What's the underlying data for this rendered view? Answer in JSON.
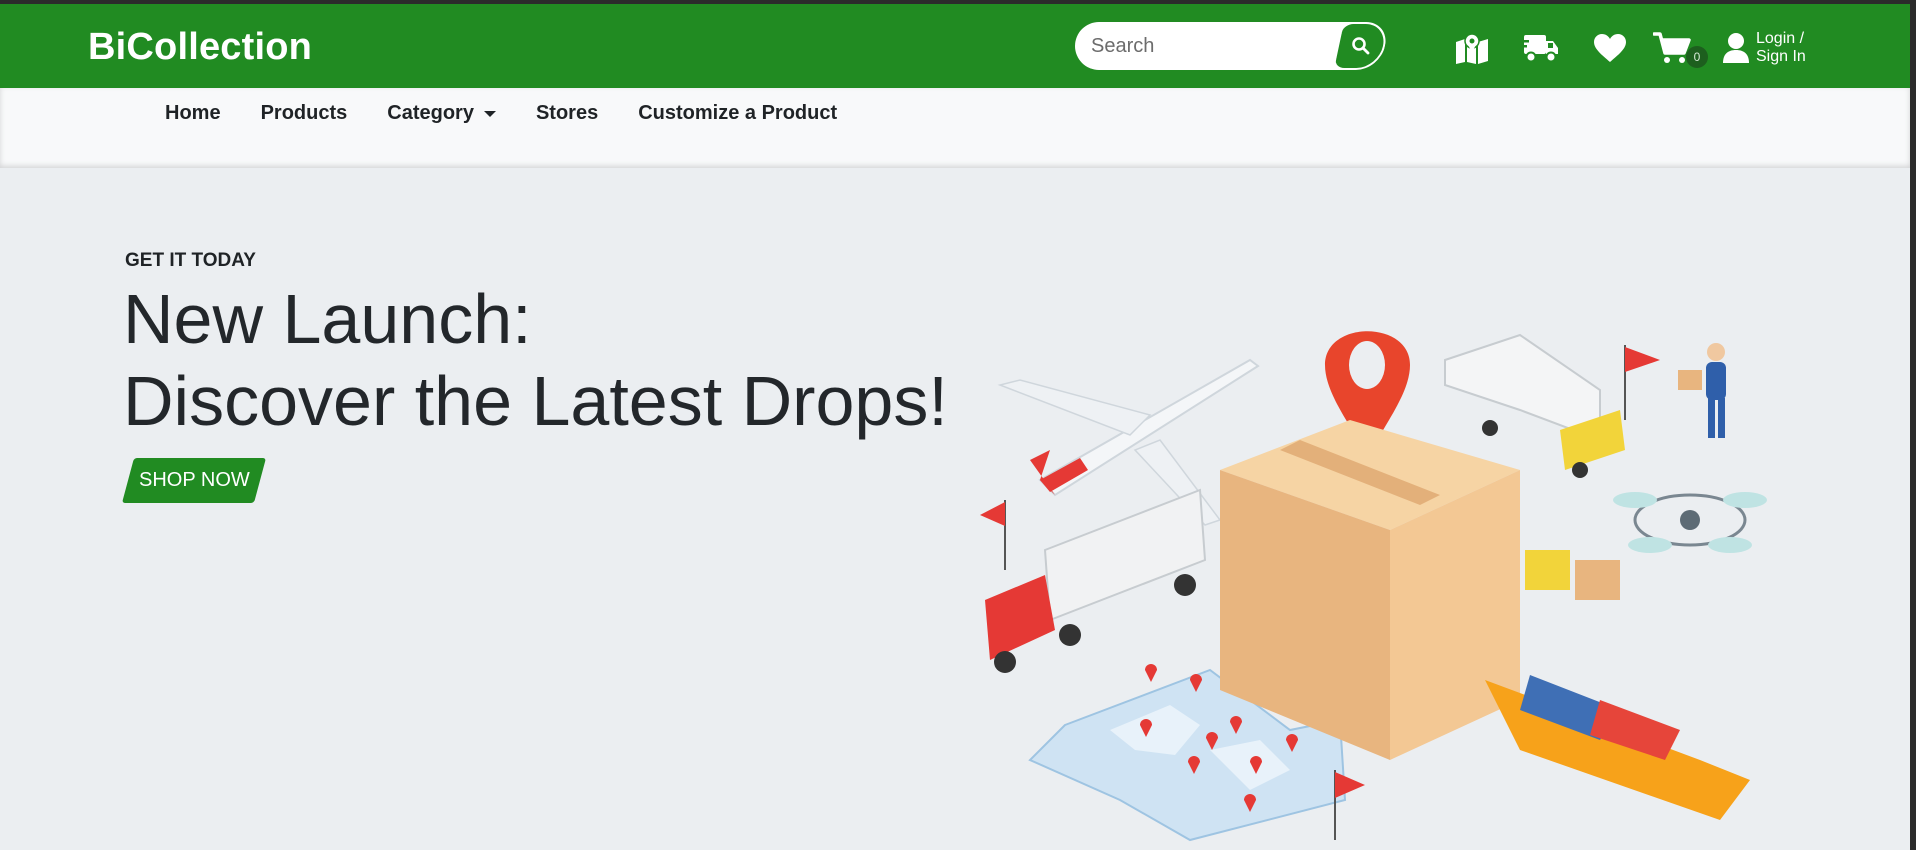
{
  "header": {
    "brand": "BiCollection",
    "search_placeholder": "Search",
    "cart_count": "0",
    "login_line1": "Login /",
    "login_line2": "Sign In"
  },
  "nav": {
    "items": [
      "Home",
      "Products",
      "Category",
      "Stores",
      "Customize a Product"
    ]
  },
  "hero": {
    "eyebrow": "GET IT TODAY",
    "headline_line1": "New Launch:",
    "headline_line2": "Discover the Latest Drops!",
    "cta": "SHOP NOW"
  },
  "icons": {
    "search": "search-icon",
    "map": "map-location-icon",
    "delivery": "delivery-truck-icon",
    "wishlist": "heart-icon",
    "cart": "cart-icon",
    "user": "user-icon"
  },
  "colors": {
    "brand_green": "#218b22",
    "nav_bg": "#f8f9fa",
    "hero_bg": "#ebeef1"
  }
}
